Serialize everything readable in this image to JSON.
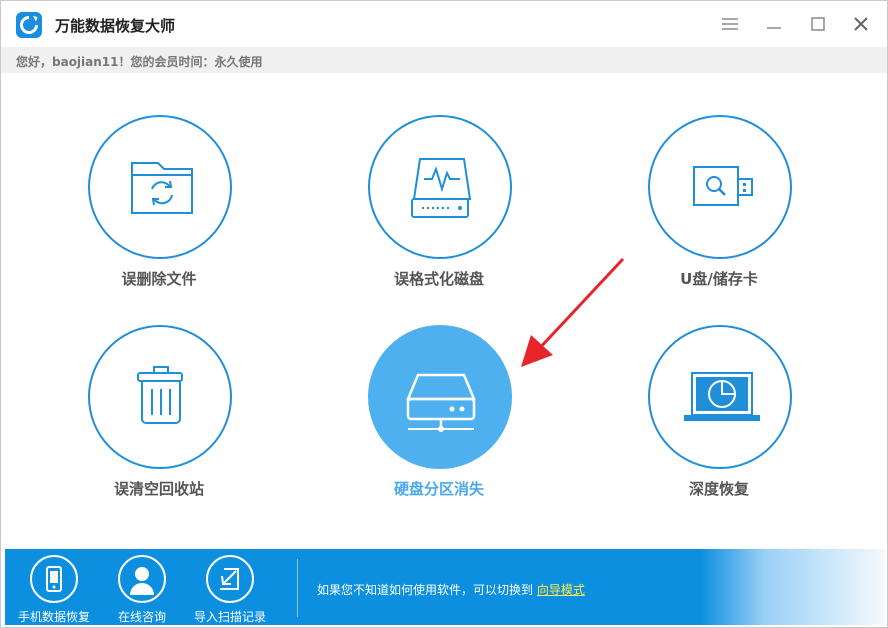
{
  "app": {
    "title": "万能数据恢复大师"
  },
  "member": {
    "text": "您好，baojian11！您的会员时间：永久使用"
  },
  "tiles": [
    {
      "label": "误删除文件",
      "icon": "folder-recycle-icon"
    },
    {
      "label": "误格式化磁盘",
      "icon": "disk-pulse-icon"
    },
    {
      "label": "U盘/储存卡",
      "icon": "usb-search-icon"
    },
    {
      "label": "误清空回收站",
      "icon": "trash-icon"
    },
    {
      "label": "硬盘分区消失",
      "icon": "hard-drive-icon"
    },
    {
      "label": "深度恢复",
      "icon": "laptop-scan-icon"
    }
  ],
  "bottom": {
    "items": [
      {
        "label": "手机数据恢复",
        "icon": "phone-icon"
      },
      {
        "label": "在线咨询",
        "icon": "person-icon"
      },
      {
        "label": "导入扫描记录",
        "icon": "import-icon"
      }
    ],
    "tip": "如果您不知道如何使用软件，可以切换到",
    "link": "向导模式"
  },
  "colors": {
    "accent": "#1e8fd8",
    "active_tile": "#4fb0f0",
    "bottom_bar": "#0d8fe0",
    "arrow": "#e8242b",
    "link": "#ffe94a"
  }
}
